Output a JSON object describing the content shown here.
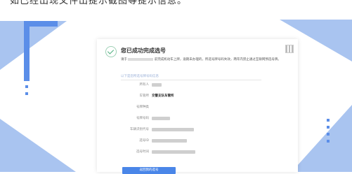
{
  "top_text": "如已经出现文件出提示截图等提示信息。",
  "panel": {
    "title": "您已成功完成选号",
    "notice_prefix": "请于",
    "notice_body": "前完成机动车上牌，逾期未办理的，所选号牌号码失效，两年内禁止通过互联网预选号牌。",
    "section_head": "以下是您所选号牌号码信息",
    "qr_label": "",
    "rows": [
      {
        "label": "所有人",
        "value": ""
      },
      {
        "label": "车管所",
        "value": "交警支队车管所"
      },
      {
        "label": "号牌种类",
        "value": ""
      },
      {
        "label": "号牌号码",
        "value": ""
      },
      {
        "label": "车辆识别代号",
        "value": ""
      },
      {
        "label": "选号ID",
        "value": ""
      },
      {
        "label": "选号时间",
        "value": ""
      }
    ],
    "button_label": "返回我的选号"
  },
  "colors": {
    "accent": "#4a86e8",
    "deco_light": "#a9c4f0",
    "deco_dark": "#5b8ee8",
    "success": "#4caf7d"
  }
}
